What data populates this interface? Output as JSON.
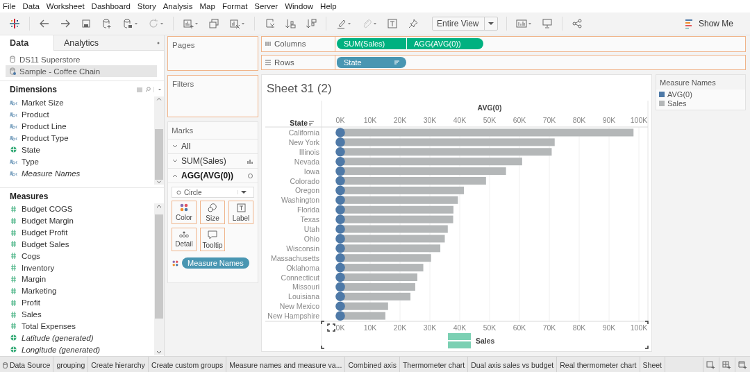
{
  "menu": [
    "File",
    "Data",
    "Worksheet",
    "Dashboard",
    "Story",
    "Analysis",
    "Map",
    "Format",
    "Server",
    "Window",
    "Help"
  ],
  "toolbar": {
    "fit_dropdown": "Entire View",
    "show_me": "Show Me"
  },
  "left_panel": {
    "tabs": [
      {
        "label": "Data",
        "selected": true
      },
      {
        "label": "Analytics",
        "selected": false
      }
    ],
    "data_sources": [
      {
        "name": "DS11 Superstore",
        "selected": false
      },
      {
        "name": "Sample - Coffee Chain",
        "selected": true
      }
    ],
    "dimensions": {
      "title": "Dimensions",
      "items": [
        {
          "name": "Market Size",
          "kind": "string",
          "generated": false
        },
        {
          "name": "Product",
          "kind": "string",
          "generated": false
        },
        {
          "name": "Product Line",
          "kind": "string",
          "generated": false
        },
        {
          "name": "Product Type",
          "kind": "string",
          "generated": false
        },
        {
          "name": "State",
          "kind": "geo",
          "generated": false
        },
        {
          "name": "Type",
          "kind": "string",
          "generated": false
        },
        {
          "name": "Measure Names",
          "kind": "string",
          "generated": true
        }
      ]
    },
    "measures": {
      "title": "Measures",
      "items": [
        {
          "name": "Budget COGS",
          "kind": "number",
          "generated": false
        },
        {
          "name": "Budget Margin",
          "kind": "number",
          "generated": false
        },
        {
          "name": "Budget Profit",
          "kind": "number",
          "generated": false
        },
        {
          "name": "Budget Sales",
          "kind": "number",
          "generated": false
        },
        {
          "name": "Cogs",
          "kind": "number",
          "generated": false
        },
        {
          "name": "Inventory",
          "kind": "number",
          "generated": false
        },
        {
          "name": "Margin",
          "kind": "number",
          "generated": false
        },
        {
          "name": "Marketing",
          "kind": "number",
          "generated": false
        },
        {
          "name": "Profit",
          "kind": "number",
          "generated": false
        },
        {
          "name": "Sales",
          "kind": "number",
          "generated": false
        },
        {
          "name": "Total Expenses",
          "kind": "number",
          "generated": false
        },
        {
          "name": "Latitude (generated)",
          "kind": "geo",
          "generated": true
        },
        {
          "name": "Longitude (generated)",
          "kind": "geo",
          "generated": true
        }
      ]
    }
  },
  "pages": {
    "title": "Pages"
  },
  "filters": {
    "title": "Filters"
  },
  "marks": {
    "title": "Marks",
    "cards": [
      {
        "label": "All",
        "expanded": false,
        "selected": false,
        "kind": "none"
      },
      {
        "label": "SUM(Sales)",
        "expanded": false,
        "selected": false,
        "kind": "bar"
      },
      {
        "label": "AGG(AVG(0))",
        "expanded": true,
        "selected": true,
        "kind": "circle"
      }
    ],
    "mark_type": "Circle",
    "buttons": [
      {
        "label": "Color",
        "kind": "color"
      },
      {
        "label": "Size",
        "kind": "size"
      },
      {
        "label": "Label",
        "kind": "label"
      },
      {
        "label": "Detail",
        "kind": "detail"
      },
      {
        "label": "Tooltip",
        "kind": "tooltip"
      }
    ],
    "pills": [
      {
        "label": "Measure Names",
        "kind": "color"
      }
    ]
  },
  "shelves": [
    {
      "label": "Columns",
      "kind": "columns",
      "pills": [
        {
          "label": "SUM(Sales)",
          "kind": "measure",
          "sorted": false
        },
        {
          "label": "AGG(AVG(0))",
          "kind": "measure",
          "sorted": false
        }
      ]
    },
    {
      "label": "Rows",
      "kind": "rows",
      "pills": [
        {
          "label": "State",
          "kind": "dimension",
          "sorted": true
        }
      ]
    }
  ],
  "sheet": {
    "title": "Sheet 31 (2)",
    "top_axis": {
      "title": "AVG(0)",
      "ticks": [
        "0K",
        "10K",
        "20K",
        "30K",
        "40K",
        "50K",
        "60K",
        "70K",
        "80K",
        "90K",
        "100K"
      ],
      "color": "#4e79a7"
    },
    "chart_data": {
      "type": "bar",
      "orientation": "horizontal",
      "ylabel": "State",
      "grid": true,
      "xlim": [
        0,
        100000
      ],
      "xticks": [
        {
          "value": 0,
          "label": "0K"
        },
        {
          "value": 10000,
          "label": "10K"
        },
        {
          "value": 20000,
          "label": "20K"
        },
        {
          "value": 30000,
          "label": "30K"
        },
        {
          "value": 40000,
          "label": "40K"
        },
        {
          "value": 50000,
          "label": "50K"
        },
        {
          "value": 60000,
          "label": "60K"
        },
        {
          "value": 70000,
          "label": "70K"
        },
        {
          "value": 80000,
          "label": "80K"
        },
        {
          "value": 90000,
          "label": "90K"
        },
        {
          "value": 100000,
          "label": "100K"
        }
      ],
      "categories": [
        "California",
        "New York",
        "Illinois",
        "Nevada",
        "Iowa",
        "Colorado",
        "Oregon",
        "Washington",
        "Florida",
        "Texas",
        "Utah",
        "Ohio",
        "Wisconsin",
        "Massachusetts",
        "Oklahoma",
        "Connecticut",
        "Missouri",
        "Louisiana",
        "New Mexico",
        "New Hampshire"
      ],
      "series": [
        {
          "name": "Sales",
          "color": "#b4b7b8",
          "values": [
            98200,
            71800,
            70800,
            60900,
            55500,
            48800,
            41400,
            39400,
            37900,
            37800,
            36000,
            35000,
            33500,
            30400,
            27800,
            25800,
            25100,
            23500,
            16000,
            15100
          ]
        }
      ]
    }
  },
  "legend": {
    "title": "Measure Names",
    "items": [
      {
        "label": "AVG(0)",
        "color": "#4e79a7"
      },
      {
        "label": "Sales",
        "color": "#b4b7b8"
      }
    ]
  },
  "sheet_tabs": [
    {
      "label": "Data Source",
      "kind": "datasource",
      "selected": false
    },
    {
      "label": "grouping",
      "kind": "sheet",
      "selected": false
    },
    {
      "label": "Create hierarchy",
      "kind": "sheet",
      "selected": false
    },
    {
      "label": "Create custom groups",
      "kind": "sheet",
      "selected": false
    },
    {
      "label": "Measure names and measure va...",
      "kind": "sheet",
      "selected": false
    },
    {
      "label": "Combined axis",
      "kind": "sheet",
      "selected": false
    },
    {
      "label": "Thermometer chart",
      "kind": "sheet",
      "selected": false
    },
    {
      "label": "Dual axis sales vs budget",
      "kind": "sheet",
      "selected": false
    },
    {
      "label": "Real thermometer chart",
      "kind": "sheet",
      "selected": false
    },
    {
      "label": "Sheet",
      "kind": "sheet",
      "selected": false
    }
  ]
}
